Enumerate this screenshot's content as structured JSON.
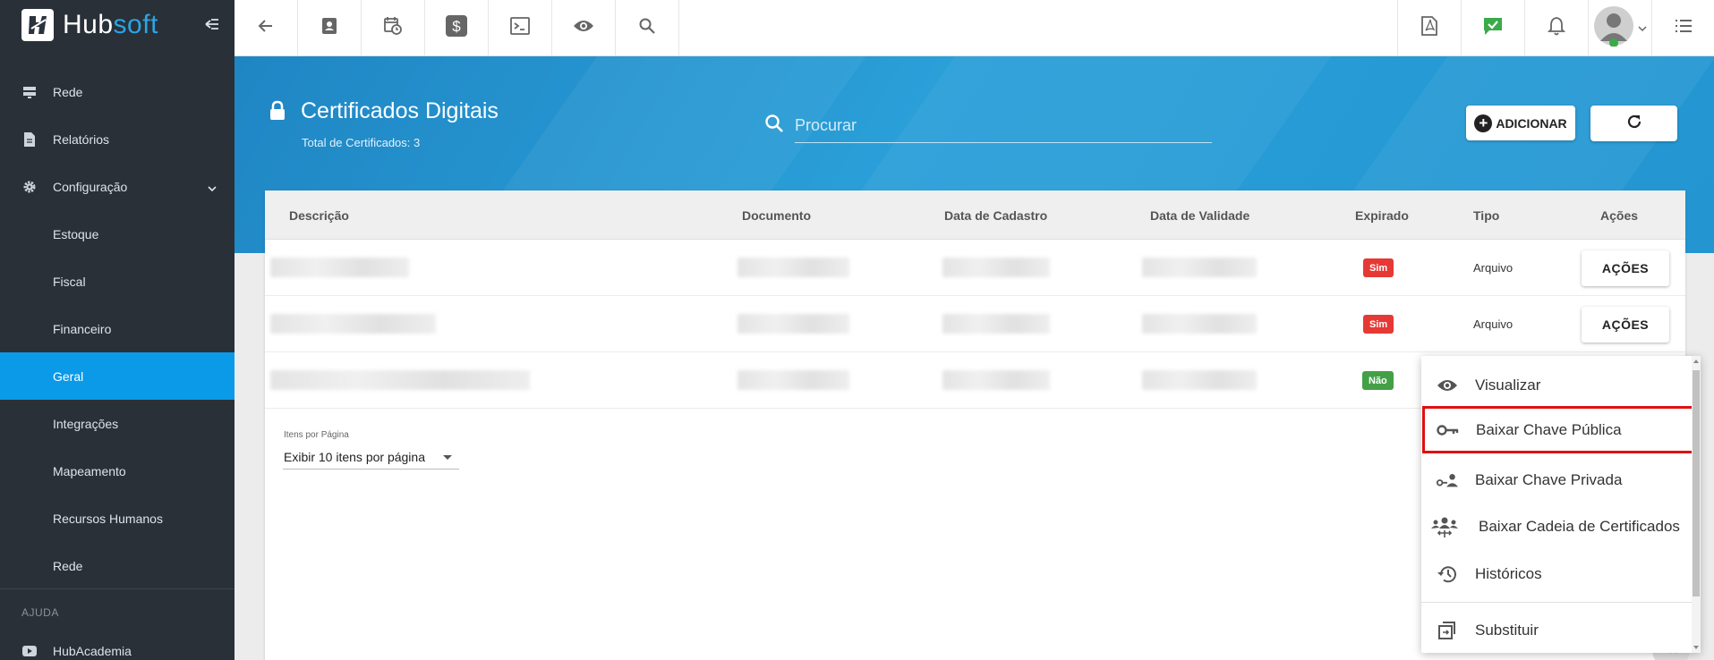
{
  "brand": {
    "name_part1": "Hub",
    "name_part2": "soft"
  },
  "sidebar": {
    "items": [
      {
        "label": "Rede",
        "icon": "server-icon"
      },
      {
        "label": "Relatórios",
        "icon": "document-icon"
      },
      {
        "label": "Configuração",
        "icon": "gear-icon"
      }
    ],
    "sub_items": [
      {
        "label": "Estoque"
      },
      {
        "label": "Fiscal"
      },
      {
        "label": "Financeiro"
      },
      {
        "label": "Geral",
        "active": true
      },
      {
        "label": "Integrações"
      },
      {
        "label": "Mapeamento"
      },
      {
        "label": "Recursos Humanos"
      },
      {
        "label": "Rede"
      }
    ],
    "section_label": "AJUDA",
    "help_items": [
      {
        "label": "HubAcademia",
        "icon": "youtube-icon"
      }
    ]
  },
  "topbar": {
    "left_icons": [
      "back-arrow-icon",
      "contact-card-icon",
      "calendar-clock-icon",
      "dollar-icon",
      "terminal-icon",
      "eye-icon",
      "search-icon"
    ],
    "right_icons": [
      "pdf-icon",
      "chat-check-icon",
      "bell-icon",
      "avatar",
      "list-menu-icon"
    ]
  },
  "page": {
    "title": "Certificados Digitais",
    "subtitle": "Total de Certificados: 3",
    "search_placeholder": "Procurar",
    "add_button": "ADICIONAR"
  },
  "table": {
    "columns": [
      "Descrição",
      "Documento",
      "Data de Cadastro",
      "Data de Validade",
      "Expirado",
      "Tipo",
      "Ações"
    ],
    "rows": [
      {
        "expirado": "Sim",
        "tipo": "Arquivo",
        "acoes": "AÇÕES"
      },
      {
        "expirado": "Sim",
        "tipo": "Arquivo",
        "acoes": "AÇÕES"
      },
      {
        "expirado": "Não",
        "tipo": "",
        "acoes": ""
      }
    ]
  },
  "pagination": {
    "label": "Itens por Página",
    "selected": "Exibir 10 itens por página"
  },
  "actions_menu": {
    "items": [
      {
        "label": "Visualizar",
        "icon": "eye-icon"
      },
      {
        "label": "Baixar Chave Pública",
        "icon": "key-icon",
        "highlighted": true
      },
      {
        "label": "Baixar Chave Privada",
        "icon": "key-person-icon"
      },
      {
        "label": "Baixar Cadeia de Certificados",
        "icon": "group-icon"
      },
      {
        "label": "Históricos",
        "icon": "history-icon"
      },
      {
        "label": "Substituir",
        "icon": "replace-icon"
      }
    ]
  },
  "colors": {
    "sidebar_bg": "#293038",
    "accent": "#0a9ae8",
    "header_band": "#2396d2",
    "badge_red": "#e53935",
    "badge_green": "#43a047",
    "highlight_outline": "#e01010"
  }
}
